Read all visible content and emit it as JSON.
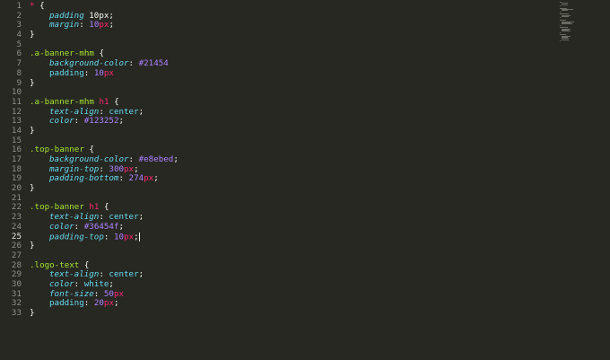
{
  "editor": {
    "active_line": 25,
    "line_numbers": [
      "1",
      "2",
      "3",
      "4",
      "5",
      "6",
      "7",
      "8",
      "9",
      "10",
      "11",
      "12",
      "13",
      "14",
      "15",
      "16",
      "17",
      "18",
      "19",
      "20",
      "21",
      "22",
      "23",
      "24",
      "25",
      "26",
      "27",
      "28",
      "29",
      "30",
      "31",
      "32",
      "33"
    ],
    "colors": {
      "background": "#272822",
      "selector": "#a6e22e",
      "property": "#66d9ef",
      "number": "#ae81ff",
      "unit": "#f92672",
      "text": "#f8f8f2",
      "gutter": "#8f908a"
    },
    "lines": [
      [
        {
          "t": "*",
          "c": "star"
        },
        {
          "t": " {",
          "c": "punc"
        }
      ],
      [
        {
          "t": "padding",
          "c": "prop"
        },
        {
          "t": " 10px;",
          "c": "punc"
        }
      ],
      [
        {
          "t": "margin",
          "c": "prop"
        },
        {
          "t": ": ",
          "c": "punc"
        },
        {
          "t": "10",
          "c": "num"
        },
        {
          "t": "px",
          "c": "unit"
        },
        {
          "t": ";",
          "c": "punc"
        }
      ],
      [
        {
          "t": "}",
          "c": "punc"
        }
      ],
      [],
      [
        {
          "t": ".a-banner-mhm",
          "c": "selector"
        },
        {
          "t": " {",
          "c": "punc"
        }
      ],
      [
        {
          "t": "background-color",
          "c": "prop"
        },
        {
          "t": ": ",
          "c": "punc"
        },
        {
          "t": "#21454",
          "c": "hex"
        }
      ],
      [
        {
          "t": "padding",
          "c": "prop-n"
        },
        {
          "t": ": ",
          "c": "punc"
        },
        {
          "t": "10",
          "c": "num"
        },
        {
          "t": "px",
          "c": "unit"
        }
      ],
      [
        {
          "t": "}",
          "c": "punc"
        }
      ],
      [],
      [
        {
          "t": ".a-banner-mhm ",
          "c": "selector"
        },
        {
          "t": "h1",
          "c": "tag"
        },
        {
          "t": " {",
          "c": "punc"
        }
      ],
      [
        {
          "t": "text-align",
          "c": "prop"
        },
        {
          "t": ": ",
          "c": "punc"
        },
        {
          "t": "center",
          "c": "word"
        },
        {
          "t": ";",
          "c": "punc"
        }
      ],
      [
        {
          "t": "color",
          "c": "prop"
        },
        {
          "t": ": ",
          "c": "punc"
        },
        {
          "t": "#123252",
          "c": "hex"
        },
        {
          "t": ";",
          "c": "punc"
        }
      ],
      [
        {
          "t": "}",
          "c": "punc"
        }
      ],
      [],
      [
        {
          "t": ".top-banner",
          "c": "selector"
        },
        {
          "t": " {",
          "c": "punc"
        }
      ],
      [
        {
          "t": "background-color",
          "c": "prop"
        },
        {
          "t": ": ",
          "c": "punc"
        },
        {
          "t": "#e8ebed",
          "c": "hex"
        },
        {
          "t": ";",
          "c": "punc"
        }
      ],
      [
        {
          "t": "margin-top",
          "c": "prop"
        },
        {
          "t": ": ",
          "c": "punc"
        },
        {
          "t": "300",
          "c": "num"
        },
        {
          "t": "px",
          "c": "unit"
        },
        {
          "t": ";",
          "c": "punc"
        }
      ],
      [
        {
          "t": "padding-bottom",
          "c": "prop"
        },
        {
          "t": ": ",
          "c": "punc"
        },
        {
          "t": "274",
          "c": "num"
        },
        {
          "t": "px",
          "c": "unit"
        },
        {
          "t": ";",
          "c": "punc"
        }
      ],
      [
        {
          "t": "}",
          "c": "punc"
        }
      ],
      [],
      [
        {
          "t": ".top-banner ",
          "c": "selector"
        },
        {
          "t": "h1",
          "c": "tag"
        },
        {
          "t": " {",
          "c": "punc"
        }
      ],
      [
        {
          "t": "text-align",
          "c": "prop"
        },
        {
          "t": ": ",
          "c": "punc"
        },
        {
          "t": "center",
          "c": "word"
        },
        {
          "t": ";",
          "c": "punc"
        }
      ],
      [
        {
          "t": "color",
          "c": "prop"
        },
        {
          "t": ": ",
          "c": "punc"
        },
        {
          "t": "#36454f",
          "c": "hex"
        },
        {
          "t": ";",
          "c": "punc"
        }
      ],
      [
        {
          "t": "padding-top",
          "c": "prop"
        },
        {
          "t": ": ",
          "c": "punc"
        },
        {
          "t": "10",
          "c": "num"
        },
        {
          "t": "px",
          "c": "unit"
        },
        {
          "t": ";",
          "c": "punc"
        },
        {
          "t": "",
          "c": "caret"
        }
      ],
      [
        {
          "t": "}",
          "c": "punc"
        }
      ],
      [],
      [
        {
          "t": ".logo-text",
          "c": "selector"
        },
        {
          "t": " {",
          "c": "punc"
        }
      ],
      [
        {
          "t": "text-align",
          "c": "prop"
        },
        {
          "t": ": ",
          "c": "punc"
        },
        {
          "t": "center",
          "c": "word"
        },
        {
          "t": ";",
          "c": "punc"
        }
      ],
      [
        {
          "t": "color",
          "c": "prop"
        },
        {
          "t": ": ",
          "c": "punc"
        },
        {
          "t": "white",
          "c": "word"
        },
        {
          "t": ";",
          "c": "punc"
        }
      ],
      [
        {
          "t": "font-size",
          "c": "prop"
        },
        {
          "t": ": ",
          "c": "punc"
        },
        {
          "t": "50",
          "c": "num"
        },
        {
          "t": "px",
          "c": "unit"
        }
      ],
      [
        {
          "t": "padding",
          "c": "prop-n"
        },
        {
          "t": ": ",
          "c": "punc"
        },
        {
          "t": "20",
          "c": "num"
        },
        {
          "t": "px",
          "c": "unit"
        },
        {
          "t": ";",
          "c": "punc"
        }
      ],
      [
        {
          "t": "}",
          "c": "punc"
        }
      ]
    ]
  }
}
